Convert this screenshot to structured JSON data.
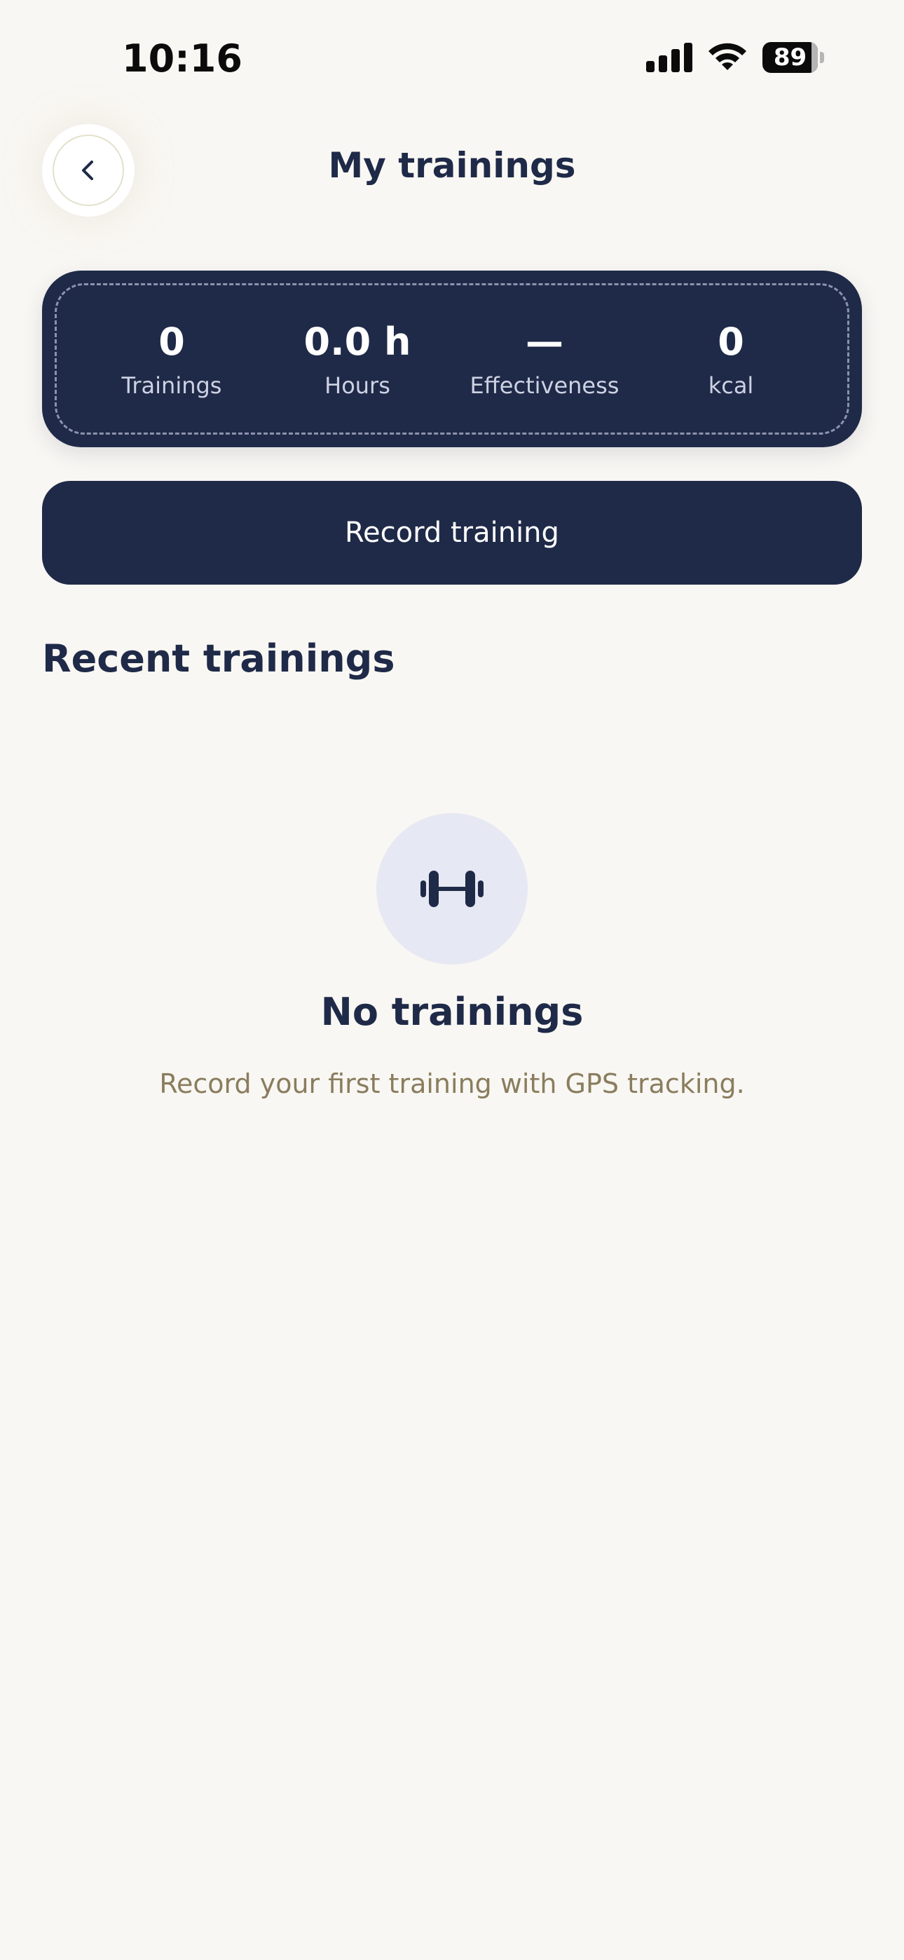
{
  "status_bar": {
    "time": "10:16",
    "battery_percent": "89",
    "battery_level": 0.89
  },
  "header": {
    "title": "My trainings",
    "back_icon": "chevron-left-icon"
  },
  "stats": [
    {
      "value": "0",
      "label": "Trainings"
    },
    {
      "value": "0.0 h",
      "label": "Hours"
    },
    {
      "value": "—",
      "label": "Effectiveness"
    },
    {
      "value": "0",
      "label": "kcal"
    }
  ],
  "actions": {
    "record_label": "Record training"
  },
  "recent": {
    "title": "Recent trainings",
    "empty": {
      "icon": "dumbbell-icon",
      "title": "No trainings",
      "subtitle": "Record your first training with GPS tracking."
    }
  },
  "colors": {
    "primary": "#1f2a48",
    "background": "#f9f7f3",
    "muted_text": "#8a7d5e",
    "icon_circle": "#e6e8f3"
  }
}
